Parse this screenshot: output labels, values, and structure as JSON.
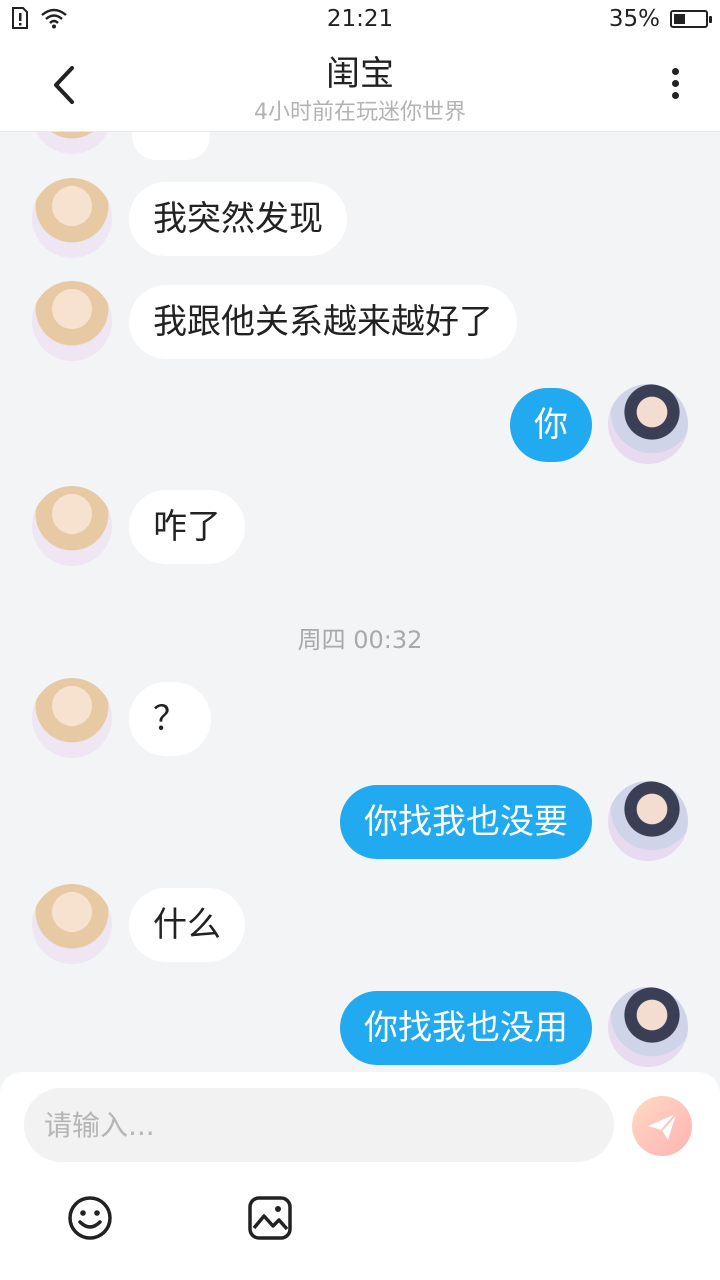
{
  "status_bar": {
    "time": "21:21",
    "battery_percent": "35%",
    "battery_level": 0.35
  },
  "header": {
    "title": "闺宝",
    "subtitle": "4小时前在玩迷你世界"
  },
  "messages": [
    {
      "side": "in",
      "text": "我突然发现"
    },
    {
      "side": "in",
      "text": "我跟他关系越来越好了"
    },
    {
      "side": "out",
      "text": "你"
    },
    {
      "side": "in",
      "text": "咋了"
    },
    {
      "side": "in",
      "text": "？"
    },
    {
      "side": "out",
      "text": "你找我也没要"
    },
    {
      "side": "in",
      "text": "什么"
    },
    {
      "side": "out",
      "text": "你找我也没用"
    }
  ],
  "timestamp": "周四 00:32",
  "composer": {
    "placeholder": "请输入..."
  },
  "icons": {
    "back": "chevron-left-icon",
    "more": "more-vertical-icon",
    "send": "send-icon",
    "emoji": "emoji-icon",
    "image": "image-icon"
  },
  "colors": {
    "outgoing_bubble": "#22aaf0",
    "incoming_bubble": "#ffffff",
    "background": "#f3f4f6",
    "send_button": "#ffc4bc"
  }
}
